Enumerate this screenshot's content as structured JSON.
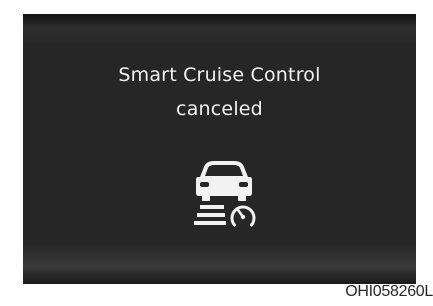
{
  "display": {
    "message_line1": "Smart Cruise Control",
    "message_line2": "canceled",
    "icon": "smart-cruise-control-icon"
  },
  "figure_code": "OHI058260L",
  "colors": {
    "screen_background": "#262626",
    "text": "#f2f2f2",
    "page_background": "#ffffff"
  }
}
